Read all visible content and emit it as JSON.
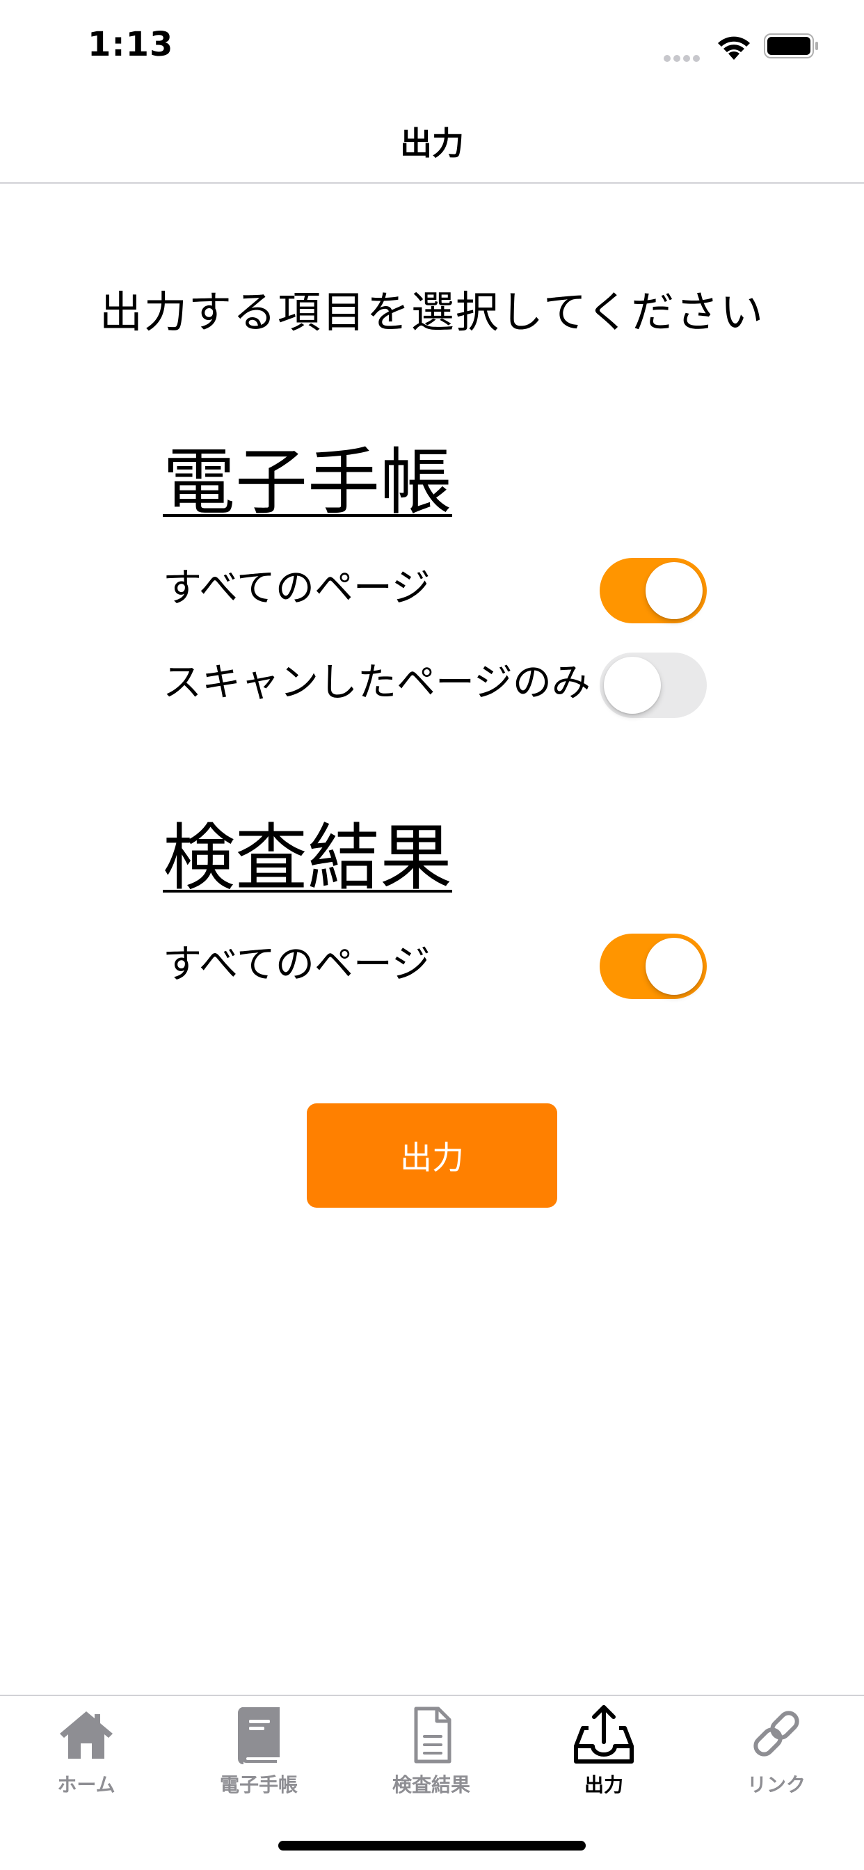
{
  "status_bar": {
    "time": "1:13"
  },
  "nav": {
    "title": "出力"
  },
  "instruction": "出力する項目を選択してください",
  "sections": [
    {
      "title": "電子手帳",
      "rows": [
        {
          "label": "すべてのページ",
          "enabled": true
        },
        {
          "label": "スキャンしたページのみ",
          "enabled": false
        }
      ]
    },
    {
      "title": "検査結果",
      "rows": [
        {
          "label": "すべてのページ",
          "enabled": true
        }
      ]
    }
  ],
  "export_button": "出力",
  "tab_bar": {
    "tabs": [
      {
        "label": "ホーム",
        "icon": "home-icon",
        "active": false
      },
      {
        "label": "電子手帳",
        "icon": "book-icon",
        "active": false
      },
      {
        "label": "検査結果",
        "icon": "document-icon",
        "active": false
      },
      {
        "label": "出力",
        "icon": "export-tray-icon",
        "active": true
      },
      {
        "label": "リンク",
        "icon": "link-icon",
        "active": false
      }
    ]
  },
  "colors": {
    "accent": "#ff9500",
    "button": "#ff8000",
    "toggle_off": "#e9e9ea",
    "inactive_tab": "#8e8e93"
  }
}
